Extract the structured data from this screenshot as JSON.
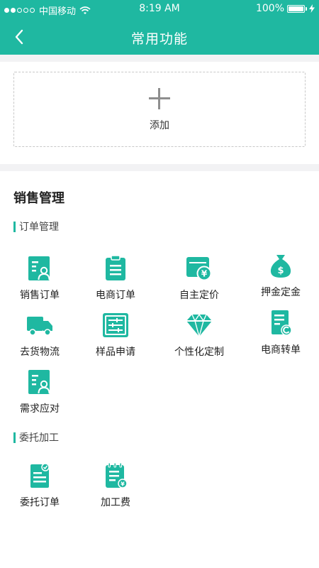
{
  "status": {
    "carrier": "中国移动",
    "time": "8:19 AM",
    "battery": "100%"
  },
  "header": {
    "title": "常用功能"
  },
  "add": {
    "label": "添加"
  },
  "section": {
    "title": "销售管理",
    "groups": [
      {
        "title": "订单管理",
        "items": [
          "销售订单",
          "电商订单",
          "自主定价",
          "押金定金",
          "去货物流",
          "样品申请",
          "个性化定制",
          "电商转单",
          "需求应对"
        ]
      },
      {
        "title": "委托加工",
        "items": [
          "委托订单",
          "加工费"
        ]
      }
    ]
  },
  "colors": {
    "accent": "#1fb8a1",
    "icon": "#1fb8a1"
  },
  "icons": [
    "doc-person-icon",
    "clipboard-icon",
    "price-tag-icon",
    "money-bag-icon",
    "truck-icon",
    "sample-form-icon",
    "gem-icon",
    "transfer-doc-icon",
    "doc-person-icon",
    "check-doc-icon",
    "fee-doc-icon"
  ]
}
